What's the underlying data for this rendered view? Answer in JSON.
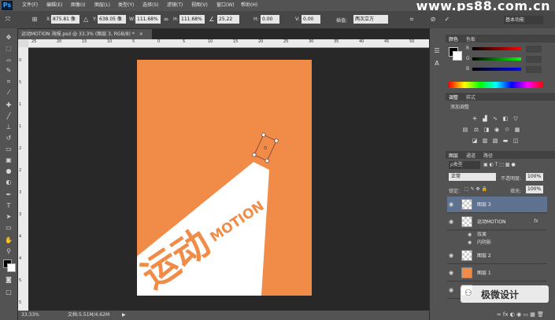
{
  "app": {
    "logo": "Ps",
    "watermark": "www.ps88.com.cn"
  },
  "menu": [
    "文件(F)",
    "编辑(E)",
    "图像(I)",
    "图层(L)",
    "类型(Y)",
    "选择(S)",
    "滤镜(T)",
    "视图(V)",
    "窗口(W)",
    "帮助(H)"
  ],
  "options": {
    "x_label": "X:",
    "x_value": "875.81 像",
    "y_label": "Y:",
    "y_value": "638.05 像",
    "w_label": "W:",
    "w_value": "111.68%",
    "h_label": "H:",
    "h_value": "111.68%",
    "angle_value": "25.22",
    "hskew_label": "H:",
    "hskew_value": "0.00",
    "vskew_label": "V:",
    "vskew_value": "0.00",
    "interp_label": "插值:",
    "interp_value": "两次立方",
    "workspace": "基本功能"
  },
  "document": {
    "tab_title": "运动MOTION 海报.psd @ 33.3% (图层 3, RGB/8) *",
    "ruler_h": [
      "25",
      "20",
      "15",
      "10",
      "5",
      "0",
      "5",
      "10",
      "15",
      "20",
      "25",
      "30",
      "35",
      "40",
      "45",
      "50"
    ],
    "ruler_v": [
      "0",
      "5",
      "1",
      "1",
      "2",
      "2",
      "3",
      "3",
      "4",
      "4",
      "5",
      "5"
    ],
    "poster_color": "#f08c48",
    "poster_text_cn": "运动",
    "poster_text_en": "MOTION"
  },
  "status": {
    "zoom": "33.33%",
    "doc": "文档:5.51M/4.62M"
  },
  "color_panel": {
    "tabs": [
      "颜色",
      "色板"
    ],
    "sliders": [
      "R",
      "G",
      "B"
    ]
  },
  "adjust_panel": {
    "tabs": [
      "调整",
      "样式"
    ],
    "title": "添加调整"
  },
  "layers_panel": {
    "tabs": [
      "图层",
      "通道",
      "路径"
    ],
    "filter_label": "ρ类型",
    "blend_mode": "正常",
    "opacity_label": "不透明度:",
    "opacity_value": "100%",
    "lock_label": "锁定:",
    "fill_label": "填充:",
    "fill_value": "100%",
    "layers": [
      {
        "name": "图层 3",
        "selected": true,
        "thumb": "checker"
      },
      {
        "name": "运动MOTION",
        "selected": false,
        "thumb": "checker",
        "fx": "fx"
      },
      {
        "name": "图层 2",
        "selected": false,
        "thumb": "checker"
      },
      {
        "name": "图层 1",
        "selected": false,
        "thumb": "orange"
      }
    ],
    "effects_label": "效果",
    "effect_inner_shadow": "内阴影"
  },
  "brand_overlay": "极微设计",
  "colors": {
    "bg": "#282828",
    "panel": "#535353",
    "accent_orange": "#f08c48",
    "selected_layer": "#5f7390"
  }
}
